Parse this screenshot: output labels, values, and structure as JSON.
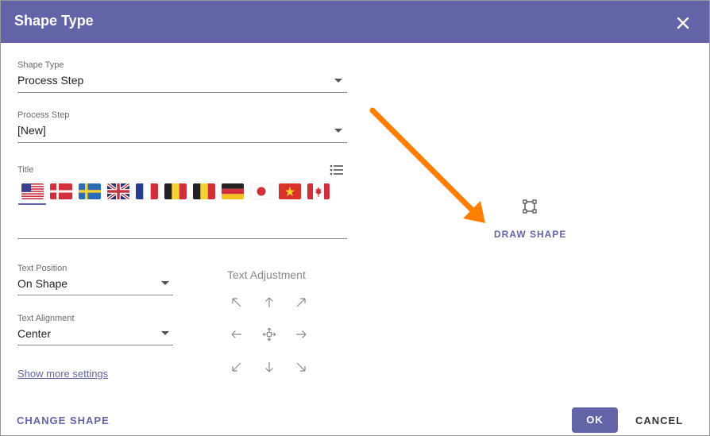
{
  "dialog": {
    "title": "Shape Type"
  },
  "shape_type": {
    "label": "Shape Type",
    "value": "Process Step"
  },
  "process_step": {
    "label": "Process Step",
    "value": "[New]"
  },
  "title_field": {
    "label": "Title",
    "value": "",
    "flags": [
      "us-flag-icon",
      "dk-flag-icon",
      "se-flag-icon",
      "gb-flag-icon",
      "fr-flag-icon",
      "be-flag-icon",
      "be-flag-icon",
      "de-flag-icon",
      "jp-flag-icon",
      "vn-flag-icon",
      "ca-flag-icon"
    ],
    "selected_flag": "us-flag-icon"
  },
  "text_position": {
    "label": "Text Position",
    "value": "On Shape"
  },
  "text_alignment": {
    "label": "Text Alignment",
    "value": "Center"
  },
  "text_adjustment": {
    "label": "Text Adjustment"
  },
  "show_more": {
    "label": "Show more settings"
  },
  "draw_shape": {
    "label": "DRAW SHAPE"
  },
  "footer": {
    "change_shape": "CHANGE SHAPE",
    "ok": "OK",
    "cancel": "CANCEL"
  },
  "colors": {
    "accent": "#6264a7",
    "annotation_arrow": "#ff8000"
  }
}
